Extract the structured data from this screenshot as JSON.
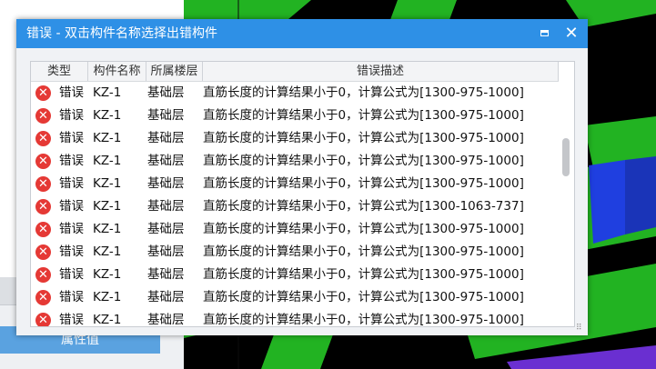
{
  "dialog": {
    "title": "错误 - 双击构件名称选择出错构件",
    "maximize_icon": "maximize-icon",
    "close_icon": "close-icon",
    "close_glyph": "✕"
  },
  "columns": {
    "type": "类型",
    "name": "构件名称",
    "floor": "所属楼层",
    "description": "错误描述"
  },
  "rows": [
    {
      "icon": "error-icon",
      "type": "错误",
      "name": "KZ-1",
      "floor": "基础层",
      "description": "直筋长度的计算结果小于0，计算公式为[1300-975-1000]"
    },
    {
      "icon": "error-icon",
      "type": "错误",
      "name": "KZ-1",
      "floor": "基础层",
      "description": "直筋长度的计算结果小于0，计算公式为[1300-975-1000]"
    },
    {
      "icon": "error-icon",
      "type": "错误",
      "name": "KZ-1",
      "floor": "基础层",
      "description": "直筋长度的计算结果小于0，计算公式为[1300-975-1000]"
    },
    {
      "icon": "error-icon",
      "type": "错误",
      "name": "KZ-1",
      "floor": "基础层",
      "description": "直筋长度的计算结果小于0，计算公式为[1300-975-1000]"
    },
    {
      "icon": "error-icon",
      "type": "错误",
      "name": "KZ-1",
      "floor": "基础层",
      "description": "直筋长度的计算结果小于0，计算公式为[1300-975-1000]"
    },
    {
      "icon": "error-icon",
      "type": "错误",
      "name": "KZ-1",
      "floor": "基础层",
      "description": "直筋长度的计算结果小于0，计算公式为[1300-1063-737]"
    },
    {
      "icon": "error-icon",
      "type": "错误",
      "name": "KZ-1",
      "floor": "基础层",
      "description": "直筋长度的计算结果小于0，计算公式为[1300-975-1000]"
    },
    {
      "icon": "error-icon",
      "type": "错误",
      "name": "KZ-1",
      "floor": "基础层",
      "description": "直筋长度的计算结果小于0，计算公式为[1300-975-1000]"
    },
    {
      "icon": "error-icon",
      "type": "错误",
      "name": "KZ-1",
      "floor": "基础层",
      "description": "直筋长度的计算结果小于0，计算公式为[1300-975-1000]"
    },
    {
      "icon": "error-icon",
      "type": "错误",
      "name": "KZ-1",
      "floor": "基础层",
      "description": "直筋长度的计算结果小于0，计算公式为[1300-975-1000]"
    },
    {
      "icon": "error-icon",
      "type": "错误",
      "name": "KZ-1",
      "floor": "基础层",
      "description": "直筋长度的计算结果小于0，计算公式为[1300-975-1000]"
    }
  ],
  "background": {
    "property_button_label": "属性值"
  },
  "colors": {
    "titlebar": "#2e90e6",
    "error_icon": "#e53935",
    "viewport_green": "#22b322",
    "viewport_blue": "#1f3fe0",
    "viewport_purple": "#6a2fd1",
    "property_button": "#5aa2e0"
  }
}
